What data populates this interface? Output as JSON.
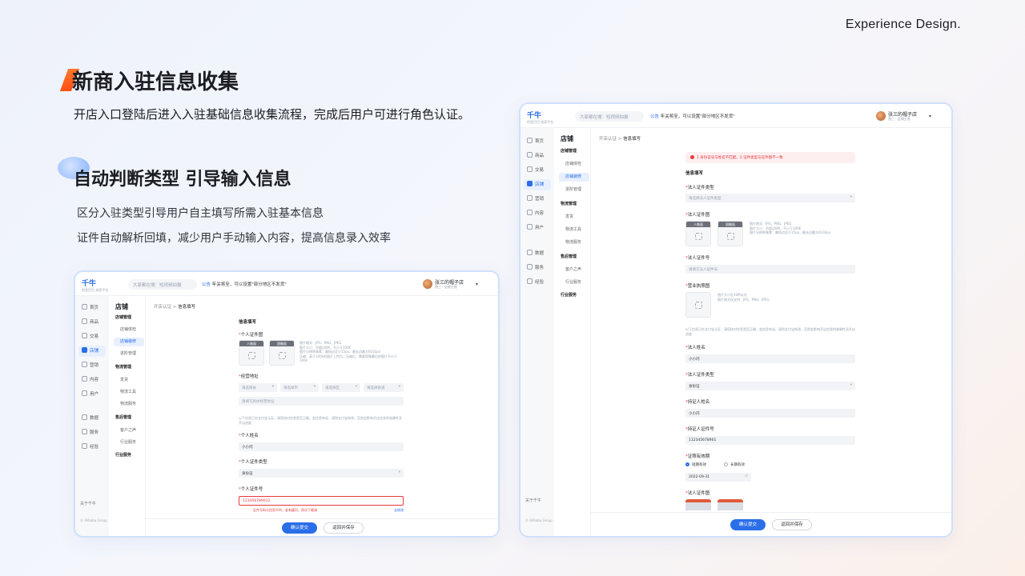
{
  "brand": "Experience Design.",
  "title": "新商入驻信息收集",
  "subtitle": "开店入口登陆后进入入驻基础信息收集流程，完成后用户可进行角色认证。",
  "section": {
    "title": "自动判断类型 引导输入信息",
    "lines": [
      "区分入驻类型引导用户自主填写所需入驻基本信息",
      "证件自动解析回填，减少用户手动输入内容，提高信息录入效率"
    ]
  },
  "app": {
    "logo": "千牛",
    "logo_sub": "阿里巴巴·卖家平台",
    "search_placeholder": "大家都在搜：短视频拍摄",
    "notice_tag": "公告",
    "notice_text": "年关将至，可以设置\"部分地区不发货\"",
    "user_name": "张三的帽子店",
    "user_role": "独三 · 店铺主账",
    "rail": [
      "首页",
      "商品",
      "交易",
      "店铺",
      "营销",
      "内容",
      "用户",
      "数据",
      "服务",
      "经验"
    ],
    "rail_footer": "关于千牛",
    "rail_copyright": "© Alibaba Group",
    "side_title": "店铺",
    "side": {
      "g1": "店铺管理",
      "g1a": "店铺体检",
      "g1b": "店铺装修",
      "g1c": "进阶管理",
      "g2": "物流管理",
      "g2a": "发货",
      "g2b": "物流工具",
      "g2c": "物流服务",
      "g3": "售后管理",
      "g3a": "客户之声",
      "g3b": "行业服务",
      "g4": "行业服务"
    },
    "crumb_parent": "开店认证",
    "crumb_current": "信息填写",
    "submit": "确认提交",
    "save": "返回并保存",
    "upload_front": "人像面",
    "upload_back": "国徽面",
    "placeholder_select": "请选择",
    "placeholder_province": "请选择省",
    "placeholder_city": "请选择市",
    "placeholder_district": "请选择区",
    "placeholder_street": "请选择街道"
  },
  "left_form": {
    "heading": "信息填写",
    "personal_id_photo": "个人证件图",
    "photo_hint": "图片格式：JPG、PNG、JPEG\n图片大小：不超过6M，不小于100K\n图片分辨率像素：最短边至少15px，最长边最大6102px\n压缩：高于100k的图片上传后，压缩后，需要保障最后的图片不小于100k",
    "address": "经营地址",
    "address_detail_placeholder": "请填写具体经营地址",
    "verify_note": "以下信息已在支付宝认证，请您核对信息是否正确，若信息有误，请到支付宝修改，否则会影响开店信息的准确性及开店进度",
    "name_label": "个人姓名",
    "name_value": "小小闪",
    "id_type_label": "个人证件类型",
    "id_type_value": "身份证",
    "id_no_label": "个人证件号",
    "id_no_value": "123456789012",
    "id_error": "证件号码与信息不符，若有疑问，再次下载请",
    "id_link": "去修改"
  },
  "right_form": {
    "alert": "1.身份证号与姓名不匹配。2.证件类型与证件图不一致",
    "heading": "信息填写",
    "legal_id_type": "法人证件类型",
    "legal_id_type_placeholder": "请选择法人证件类型",
    "legal_id_photo": "法人证件图",
    "photo_hint": "图片格式：JPG、PNG、JPEG\n图片大小：不超过6M，不小于100K\n图片分辨率像素：最短边至少15px，最长边最大6102px",
    "legal_id_no": "法人证件号",
    "legal_id_no_placeholder": "请填写法人证件号",
    "license": "营业执照图",
    "license_hint": "图片大小在10M以内\n图片格式仅支持：JPG、PNG、JPEG",
    "verify_note": "以下信息已在支付宝认证，请您核对信息是否正确，若信息有误，请到支付宝修改，否则会影响开店信息的准确性及开店进度",
    "legal_name": "法人姓名",
    "legal_name_value": "小小闪",
    "legal_type2": "法人证件类型",
    "legal_type2_value": "身份证",
    "holder_name": "持证人姓名",
    "holder_name_value": "小小闪",
    "holder_no": "持证人证件号",
    "holder_no_value": "112345678901",
    "validity": "证照有效期",
    "validity_short": "短期有效",
    "validity_long": "长期有效",
    "validity_date": "2022-09-31",
    "legal_id_photo2": "法人证件图"
  }
}
